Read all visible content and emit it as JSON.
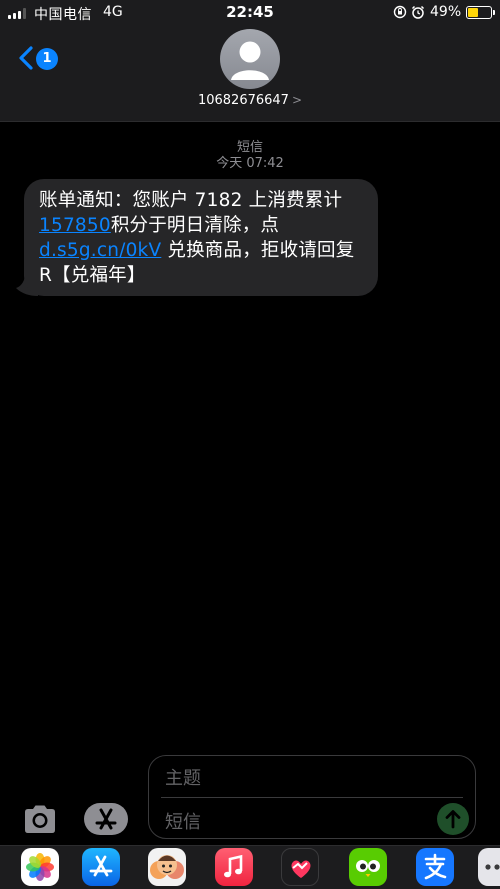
{
  "status_bar": {
    "carrier": "中国电信",
    "network": "4G",
    "time": "22:45",
    "battery_percent": "49%",
    "battery_level": 0.49,
    "icons": [
      "signal-icon",
      "screen-lock-rotation-icon",
      "alarm-icon",
      "battery-icon"
    ]
  },
  "header": {
    "back_badge": "1",
    "contact_number": "10682676647",
    "contact_chevron": ">",
    "icons": [
      "chevron-left-icon",
      "avatar-person-icon"
    ]
  },
  "conversation": {
    "thread_label": "短信",
    "timestamp": "今天 07:42",
    "message": {
      "part1": "账单通知：您账户 7182 上消费累计",
      "points": "157850",
      "part2": "积分于明日清除，点",
      "link": "d.s5g.cn/0kV",
      "part3": " 兑换商品，拒收请回复R【兑福年】"
    }
  },
  "input": {
    "subject_placeholder": "主题",
    "message_placeholder": "短信",
    "icons": [
      "camera-icon",
      "app-store-icon",
      "send-arrow-icon"
    ]
  },
  "app_drawer": {
    "apps": [
      "photos-icon",
      "app-store-icon",
      "memoji-icon",
      "music-icon",
      "digital-touch-icon",
      "duolingo-icon",
      "alipay-icon",
      "more-icon"
    ]
  },
  "colors": {
    "link": "#0a84ff",
    "bubble": "#262628",
    "send_disabled": "#1f4f2a",
    "battery": "#ffd60a"
  }
}
